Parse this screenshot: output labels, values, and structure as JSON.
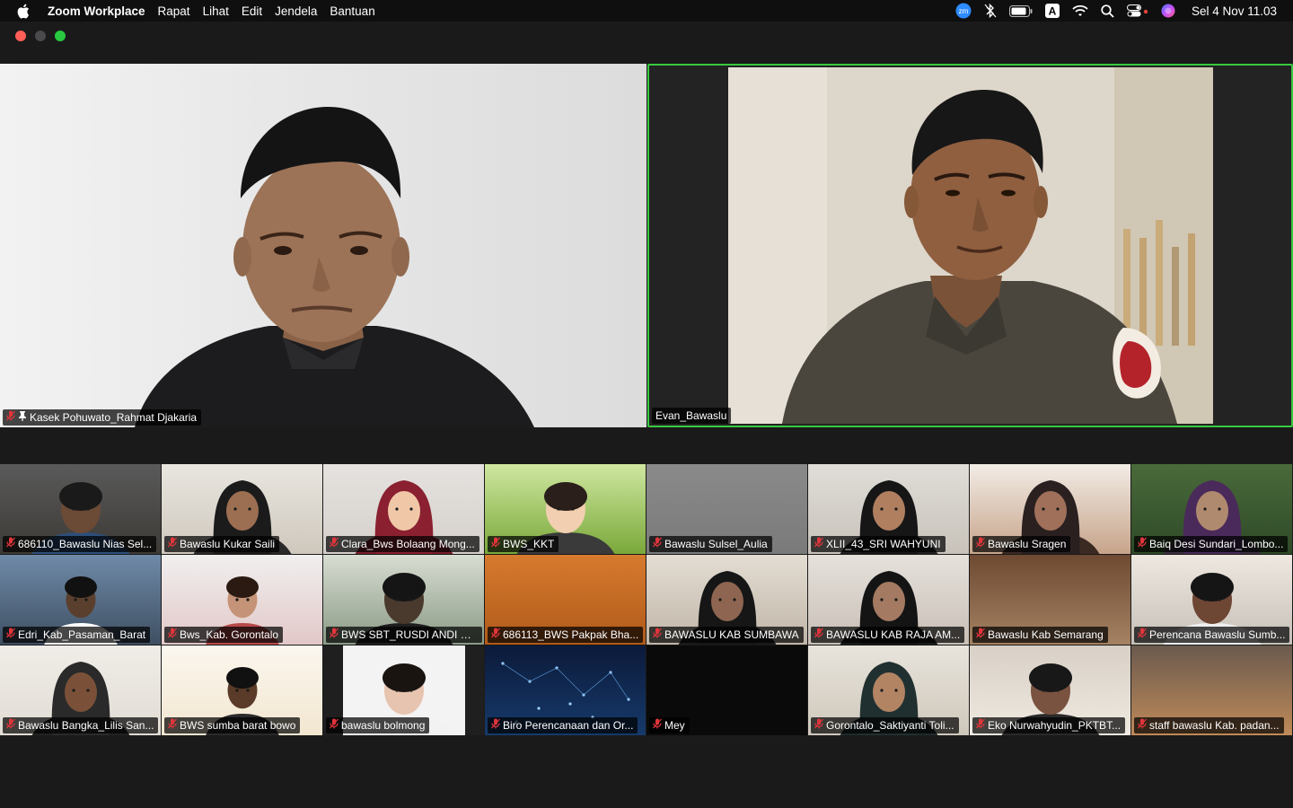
{
  "menubar": {
    "app_name": "Zoom Workplace",
    "menus": [
      "Rapat",
      "Lihat",
      "Edit",
      "Jendela",
      "Bantuan"
    ],
    "status_icons": [
      "zoom-icon",
      "bluetooth-icon",
      "battery-icon",
      "input-source-icon",
      "wifi-icon",
      "spotlight-icon",
      "control-center-icon",
      "siri-icon"
    ],
    "input_source": "A",
    "zoom_badge": "zm",
    "clock": "Sel 4 Nov  11.03"
  },
  "speakers": [
    {
      "name": "Kasek Pohuwato_Rahmat Djakaria",
      "muted": true,
      "pinned": true
    },
    {
      "name": "Evan_Bawaslu",
      "muted": false,
      "pinned": false,
      "active_speaker": true
    }
  ],
  "gallery": [
    {
      "name": "686110_Bawaslu Nias Sel...",
      "muted": true
    },
    {
      "name": "Bawaslu Kukar Saili",
      "muted": true
    },
    {
      "name": "Clara_Bws Bolaang Mong...",
      "muted": true
    },
    {
      "name": "BWS_KKT",
      "muted": true
    },
    {
      "name": "Bawaslu Sulsel_Aulia",
      "muted": true
    },
    {
      "name": "XLII_43_SRI WAHYUNI",
      "muted": true
    },
    {
      "name": "Bawaslu Sragen",
      "muted": true
    },
    {
      "name": "Baiq Desi Sundari_Lombo...",
      "muted": true
    },
    {
      "name": "Edri_Kab_Pasaman_Barat",
      "muted": true
    },
    {
      "name": "Bws_Kab. Gorontalo",
      "muted": true
    },
    {
      "name": "BWS SBT_RUSDI ANDI O...",
      "muted": true
    },
    {
      "name": "686113_BWS Pakpak Bha...",
      "muted": true
    },
    {
      "name": "BAWASLU KAB SUMBAWA",
      "muted": true
    },
    {
      "name": "BAWASLU KAB RAJA AM...",
      "muted": true
    },
    {
      "name": "Bawaslu Kab Semarang",
      "muted": true
    },
    {
      "name": "Perencana Bawaslu Sumb...",
      "muted": true
    },
    {
      "name": "Bawaslu Bangka_Lilis San...",
      "muted": true
    },
    {
      "name": "BWS sumba barat bowo",
      "muted": true
    },
    {
      "name": "bawaslu bolmong",
      "muted": true
    },
    {
      "name": "Biro Perencanaan dan Or...",
      "muted": true
    },
    {
      "name": "Mey",
      "muted": true
    },
    {
      "name": "Gorontalo_Saktiyanti Toli...",
      "muted": true
    },
    {
      "name": "Eko Nurwahyudin_PKTBT...",
      "muted": true
    },
    {
      "name": "staff bawaslu Kab. padan...",
      "muted": true
    }
  ],
  "colors": {
    "active_speaker_border": "#39c940",
    "muted_icon": "#e0353b",
    "label_bg": "rgba(0,0,0,0.72)"
  }
}
